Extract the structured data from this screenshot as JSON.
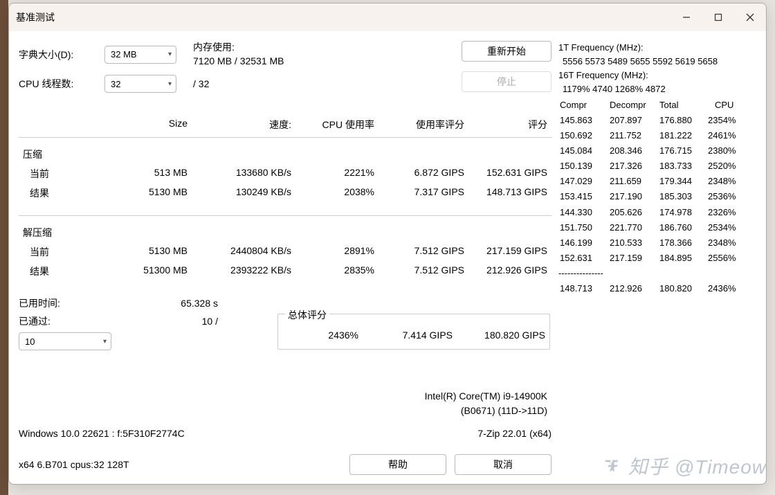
{
  "window": {
    "title": "基准测试"
  },
  "controls": {
    "dict_label": "字典大小(D):",
    "dict_value": "32 MB",
    "threads_label": "CPU 线程数:",
    "threads_value": "32",
    "threads_max": "/ 32",
    "mem_label": "内存使用:",
    "mem_value": "7120 MB / 32531 MB",
    "restart": "重新开始",
    "stop": "停止"
  },
  "headers": {
    "size": "Size",
    "speed": "速度:",
    "cpu_usage": "CPU 使用率",
    "usage_rating": "使用率评分",
    "rating": "评分"
  },
  "groups": {
    "compress": "压缩",
    "decompress": "解压缩",
    "current": "当前",
    "result": "结果"
  },
  "compress": {
    "current": {
      "size": "513 MB",
      "speed": "133680 KB/s",
      "cpu": "2221%",
      "ur": "6.872 GIPS",
      "rating": "152.631 GIPS"
    },
    "result": {
      "size": "5130 MB",
      "speed": "130249 KB/s",
      "cpu": "2038%",
      "ur": "7.317 GIPS",
      "rating": "148.713 GIPS"
    }
  },
  "decompress": {
    "current": {
      "size": "5130 MB",
      "speed": "2440804 KB/s",
      "cpu": "2891%",
      "ur": "7.512 GIPS",
      "rating": "217.159 GIPS"
    },
    "result": {
      "size": "51300 MB",
      "speed": "2393222 KB/s",
      "cpu": "2835%",
      "ur": "7.512 GIPS",
      "rating": "212.926 GIPS"
    }
  },
  "elapsed": {
    "label": "已用时间:",
    "value": "65.328 s",
    "passes_label": "已通过:",
    "passes_value": "10 /",
    "passes_select": "10"
  },
  "overall": {
    "label": "总体评分",
    "cpu": "2436%",
    "ur": "7.414 GIPS",
    "rating": "180.820 GIPS"
  },
  "cpu_info": {
    "line1": "Intel(R) Core(TM) i9-14900K",
    "line2": "(B0671) (11D->11D)"
  },
  "os_line": "Windows 10.0 22621 :  f:5F310F2774C",
  "zip_line": "7-Zip 22.01 (x64)",
  "arch_line": "x64 6.B701 cpus:32 128T",
  "buttons": {
    "help": "帮助",
    "cancel": "取消"
  },
  "side": {
    "f1t_label": "1T Frequency (MHz):",
    "f1t_values": "5556 5573 5489 5655 5592 5619 5658",
    "f16t_label": "16T Frequency (MHz):",
    "f16t_values": "1179% 4740 1268% 4872",
    "hdr_compr": "Compr",
    "hdr_decompr": "Decompr",
    "hdr_total": "Total",
    "hdr_cpu": "CPU",
    "rows": [
      {
        "c": "145.863",
        "d": "207.897",
        "t": "176.880",
        "p": "2354%"
      },
      {
        "c": "150.692",
        "d": "211.752",
        "t": "181.222",
        "p": "2461%"
      },
      {
        "c": "145.084",
        "d": "208.346",
        "t": "176.715",
        "p": "2380%"
      },
      {
        "c": "150.139",
        "d": "217.326",
        "t": "183.733",
        "p": "2520%"
      },
      {
        "c": "147.029",
        "d": "211.659",
        "t": "179.344",
        "p": "2348%"
      },
      {
        "c": "153.415",
        "d": "217.190",
        "t": "185.303",
        "p": "2536%"
      },
      {
        "c": "144.330",
        "d": "205.626",
        "t": "174.978",
        "p": "2326%"
      },
      {
        "c": "151.750",
        "d": "221.770",
        "t": "186.760",
        "p": "2534%"
      },
      {
        "c": "146.199",
        "d": "210.533",
        "t": "178.366",
        "p": "2348%"
      },
      {
        "c": "152.631",
        "d": "217.159",
        "t": "184.895",
        "p": "2556%"
      }
    ],
    "dash": "---------------",
    "summary": {
      "c": "148.713",
      "d": "212.926",
      "t": "180.820",
      "p": "2436%"
    }
  },
  "watermark": "知乎 @Timeow"
}
